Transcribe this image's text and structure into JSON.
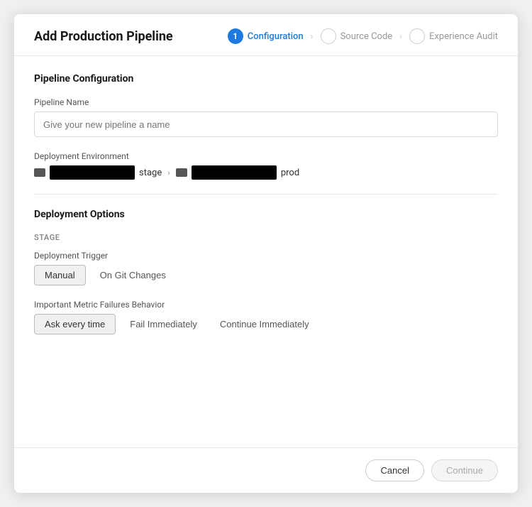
{
  "modal": {
    "title": "Add Production Pipeline"
  },
  "wizard": {
    "steps": [
      {
        "id": "configuration",
        "label": "Configuration",
        "number": "1",
        "active": true
      },
      {
        "id": "source-code",
        "label": "Source Code",
        "active": false
      },
      {
        "id": "experience-audit",
        "label": "Experience Audit",
        "active": false
      }
    ]
  },
  "sections": {
    "pipeline_config": {
      "title": "Pipeline Configuration",
      "pipeline_name_label": "Pipeline Name",
      "pipeline_name_placeholder": "Give your new pipeline a name",
      "deployment_env_label": "Deployment Environment",
      "stage_suffix": "stage",
      "prod_suffix": "prod"
    },
    "deployment_options": {
      "title": "Deployment Options",
      "stage_label": "STAGE",
      "trigger_label": "Deployment Trigger",
      "trigger_options": [
        {
          "id": "manual",
          "label": "Manual",
          "selected": true
        },
        {
          "id": "on-git-changes",
          "label": "On Git Changes",
          "selected": false
        }
      ],
      "metric_label": "Important Metric Failures Behavior",
      "metric_options": [
        {
          "id": "ask-every-time",
          "label": "Ask every time",
          "selected": true
        },
        {
          "id": "fail-immediately",
          "label": "Fail Immediately",
          "selected": false
        },
        {
          "id": "continue-immediately",
          "label": "Continue Immediately",
          "selected": false
        }
      ]
    }
  },
  "footer": {
    "cancel_label": "Cancel",
    "continue_label": "Continue"
  }
}
